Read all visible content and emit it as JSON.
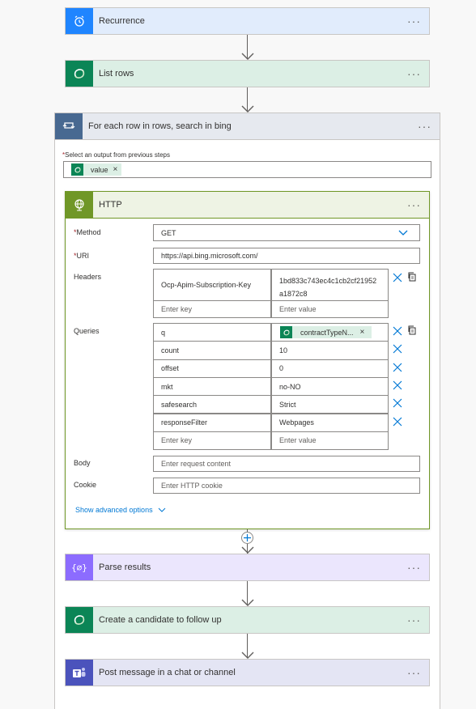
{
  "steps": {
    "recurrence": {
      "title": "Recurrence",
      "icon": "alarm-clock-icon",
      "color": "#1f85ff"
    },
    "list_rows": {
      "title": "List rows",
      "icon": "dataverse-icon",
      "color": "#0b8556"
    },
    "foreach": {
      "title": "For each row in rows, search in bing",
      "icon": "loop-icon",
      "color": "#486991",
      "select_label": "Select an output from previous steps",
      "token": "value"
    },
    "http": {
      "title": "HTTP",
      "icon": "globe-icon",
      "color": "#709727",
      "method_label": "Method",
      "method_value": "GET",
      "uri_label": "URI",
      "uri_value": "https://api.bing.microsoft.com/",
      "headers_label": "Headers",
      "headers": [
        {
          "key": "Ocp-Apim-Subscription-Key",
          "value": "1bd833c743ec4c1cb2cf21952a1872c8"
        }
      ],
      "key_placeholder": "Enter key",
      "value_placeholder": "Enter value",
      "queries_label": "Queries",
      "queries": [
        {
          "key": "q",
          "value_token": "contractTypeN..."
        },
        {
          "key": "count",
          "value": "10"
        },
        {
          "key": "offset",
          "value": "0"
        },
        {
          "key": "mkt",
          "value": "no-NO"
        },
        {
          "key": "safesearch",
          "value": "Strict"
        },
        {
          "key": "responseFilter",
          "value": "Webpages"
        }
      ],
      "body_label": "Body",
      "body_placeholder": "Enter request content",
      "cookie_label": "Cookie",
      "cookie_placeholder": "Enter HTTP cookie",
      "advanced": "Show advanced options"
    },
    "parse": {
      "title": "Parse results",
      "icon": "parse-json-icon",
      "color": "#8c6cff"
    },
    "create": {
      "title": "Create a candidate to follow up",
      "icon": "dataverse-icon",
      "color": "#0b8556"
    },
    "post": {
      "title": "Post message in a chat or channel",
      "icon": "teams-icon",
      "color": "#4b53bc"
    }
  },
  "more_label": "···",
  "required_mark": "*"
}
